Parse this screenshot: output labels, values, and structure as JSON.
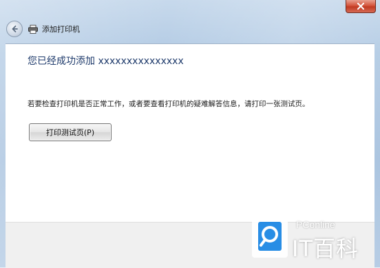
{
  "window": {
    "title": "添加打印机",
    "close_icon": "close-icon",
    "back_icon": "back-arrow-icon",
    "title_icon": "printer-icon"
  },
  "content": {
    "heading": "您已经成功添加 xxxxxxxxxxxxxxx",
    "description": "若要检查打印机是否正常工作，或者要查看打印机的疑难解答信息，请打印一张测试页。",
    "print_test_button": "打印测试页(P)"
  },
  "watermark": {
    "brand": "PConline",
    "label": "IT百科"
  },
  "colors": {
    "heading": "#1e3a6b",
    "close_button": "#c13a22",
    "frame": "#b3cbe4",
    "watermark_accent": "#1e88e5"
  }
}
